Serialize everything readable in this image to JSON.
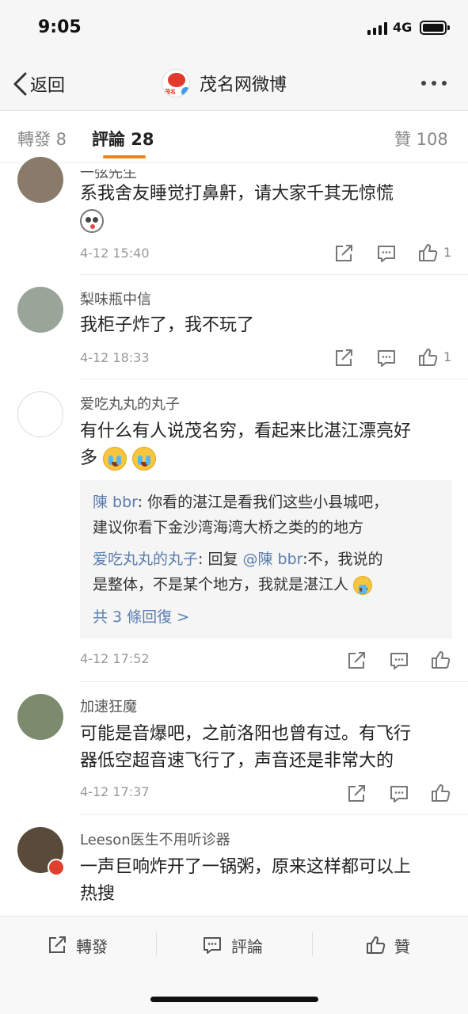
{
  "status_bar": {
    "time": "9:05",
    "network": "4G"
  },
  "nav": {
    "back_label": "返回",
    "title": "茂名网微博",
    "logo_text": "茂名"
  },
  "tabs": {
    "repost": "轉發 8",
    "comment": "評論 28",
    "like": "贊 108"
  },
  "comments": [
    {
      "username": "一弦先生",
      "text": "系我舍友睡觉打鼻鼾，请大家千其无惊慌",
      "date": "4-12 15:40",
      "like_count": "1"
    },
    {
      "username": "梨味瓶中信",
      "text": "我柜子炸了，我不玩了",
      "date": "4-12 18:33",
      "like_count": "1"
    },
    {
      "username": "爱吃丸丸的丸子",
      "text_line1": "有什么有人说茂名穷，看起来比湛江漂亮好",
      "text_line2": "多",
      "date": "4-12 17:52",
      "replies": [
        {
          "name": "陳 bbr",
          "line1": ": 你看的湛江是看我们这些小县城吧，",
          "line2": "建议你看下金沙湾海湾大桥之类的的地方"
        },
        {
          "name": "爱吃丸丸的丸子",
          "reply_word": ": 回复 ",
          "mention": "@陳 bbr",
          "line1": ":不，我说的",
          "line2": "是整体，不是某个地方，我就是湛江人"
        }
      ],
      "more_replies": "共 3 條回復 >"
    },
    {
      "username": "加速狂魔",
      "text_line1": "可能是音爆吧，之前洛阳也曾有过。有飞行",
      "text_line2": "器低空超音速飞行了，声音还是非常大的",
      "date": "4-12 17:37"
    },
    {
      "username": "Leeson医生不用听诊器",
      "text_line1": "一声巨响炸开了一锅粥，原来这样都可以上",
      "text_line2": "热搜"
    }
  ],
  "toolbar": {
    "repost": "轉發",
    "comment": "評論",
    "like": "贊"
  },
  "colors": {
    "accent": "#ff8200",
    "link": "#5b7dae",
    "background": "#ffffff"
  }
}
